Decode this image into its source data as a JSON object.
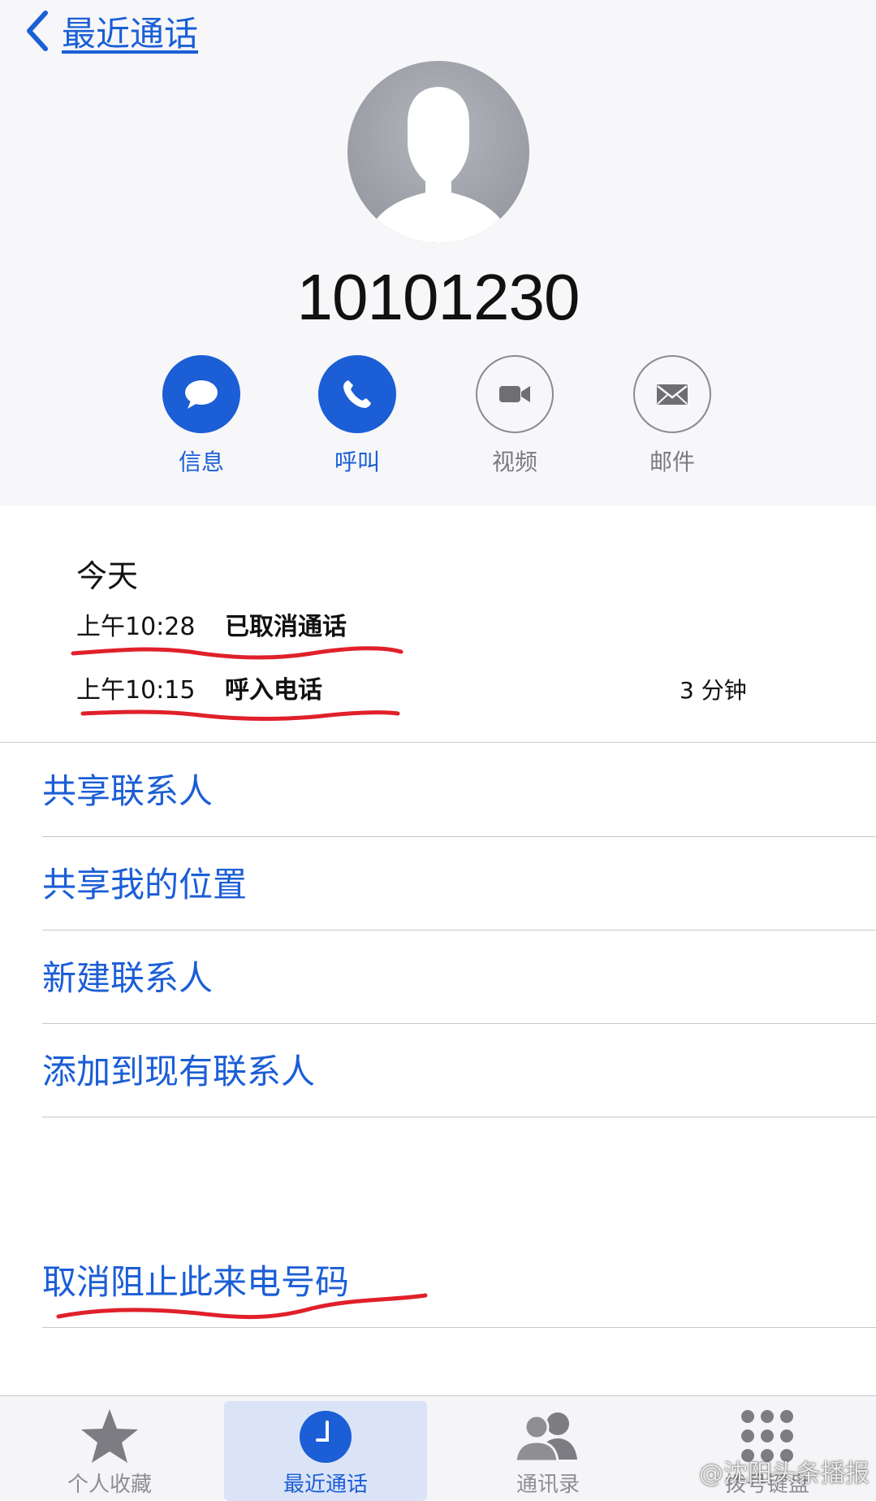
{
  "nav": {
    "back_label": "最近通话"
  },
  "contact": {
    "number": "10101230"
  },
  "actions": [
    {
      "label": "信息",
      "icon": "message-bubble-icon"
    },
    {
      "label": "呼叫",
      "icon": "phone-icon"
    },
    {
      "label": "视频",
      "icon": "video-camera-icon"
    },
    {
      "label": "邮件",
      "icon": "mail-envelope-icon"
    }
  ],
  "call_log": {
    "heading": "今天",
    "entries": [
      {
        "time": "上午10:28",
        "type": "已取消通话",
        "duration": ""
      },
      {
        "time": "上午10:15",
        "type": "呼入电话",
        "duration": "3 分钟"
      }
    ]
  },
  "menu": [
    {
      "label": "共享联系人"
    },
    {
      "label": "共享我的位置"
    },
    {
      "label": "新建联系人"
    },
    {
      "label": "添加到现有联系人"
    }
  ],
  "unblock": {
    "label": "取消阻止此来电号码"
  },
  "tabs": [
    {
      "label": "个人收藏",
      "icon": "star-icon",
      "active": false
    },
    {
      "label": "最近通话",
      "icon": "clock-icon",
      "active": true
    },
    {
      "label": "通讯录",
      "icon": "contacts-people-icon",
      "active": false
    },
    {
      "label": "拨号键盘",
      "icon": "keypad-icon",
      "active": false
    }
  ],
  "watermark": {
    "text": "@沈阳头条播报"
  },
  "colors": {
    "accent": "#1b5ed6",
    "annotation_red": "#e0202a",
    "header_bg": "#f7f7f9",
    "separator": "#c8c7cc"
  }
}
